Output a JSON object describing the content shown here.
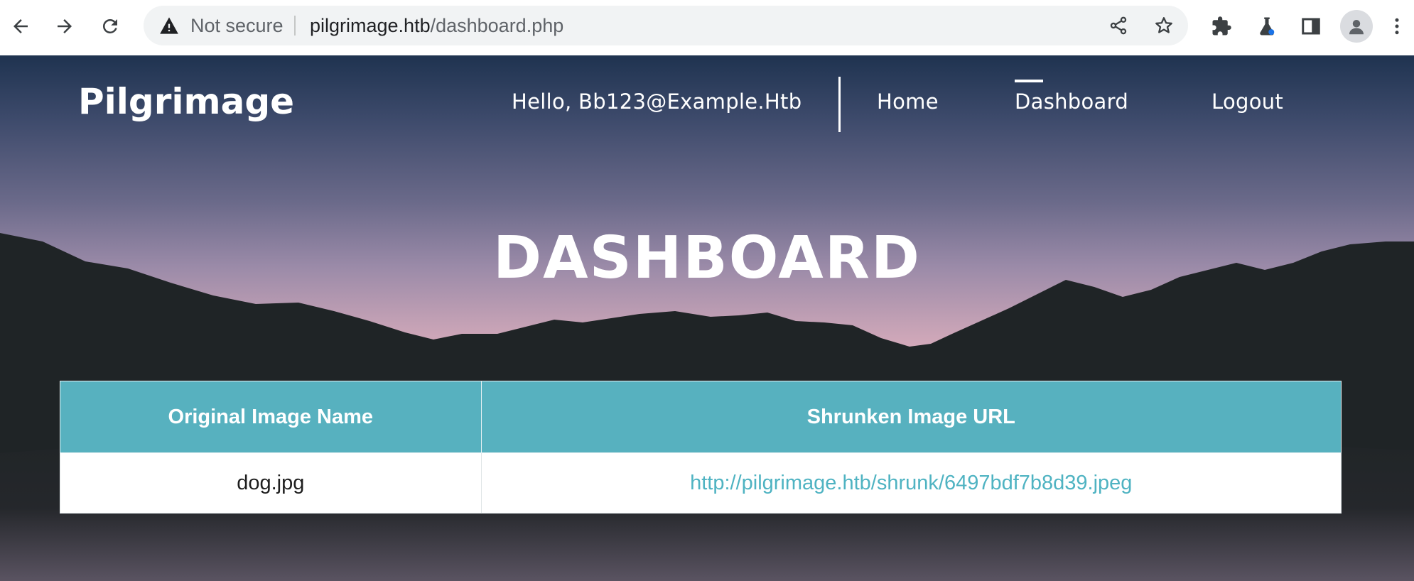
{
  "browser": {
    "security_label": "Not secure",
    "url_host": "pilgrimage.htb",
    "url_path": "/dashboard.php",
    "icons": [
      "back-arrow-icon",
      "forward-arrow-icon",
      "reload-icon",
      "warning-triangle-icon",
      "share-icon",
      "bookmark-star-icon",
      "extensions-puzzle-icon",
      "labs-flask-icon",
      "side-panel-icon",
      "profile-avatar-icon",
      "more-vert-icon"
    ]
  },
  "site": {
    "brand": "Pilgrimage",
    "nav": {
      "greeting": "Hello, Bb123@Example.Htb",
      "home": "Home",
      "dashboard": "Dashboard",
      "logout": "Logout"
    },
    "hero_title": "DASHBOARD"
  },
  "table": {
    "headers": [
      "Original Image Name",
      "Shrunken Image URL"
    ],
    "rows": [
      {
        "name": "dog.jpg",
        "url": "http://pilgrimage.htb/shrunk/6497bdf7b8d39.jpeg"
      }
    ]
  },
  "colors": {
    "table_header_bg": "#57b1bf",
    "link_color": "#4fb3c2",
    "hills": "#1f2426"
  }
}
